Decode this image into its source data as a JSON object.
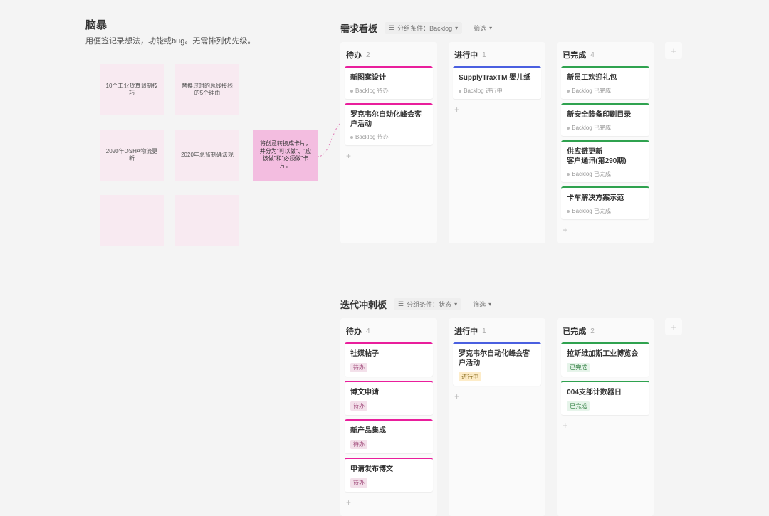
{
  "brainstorm": {
    "title": "脑暴",
    "subtitle": "用便签记录想法，功能或bug。无需排列优先级。"
  },
  "stickies": [
    {
      "text": "10个工业货真调制技巧"
    },
    {
      "text": "替换过时的总线接线的5个理由"
    },
    {
      "text": "2020年OSHA物流更新"
    },
    {
      "text": "2020年总监制确法规"
    },
    {
      "text": ""
    },
    {
      "text": ""
    }
  ],
  "pink_sticky": {
    "text": "将创意转换成卡片，并分为\"可以做\"、\"应该做\"和\"必须做\"卡片。"
  },
  "board1": {
    "title": "需求看板",
    "filter_label": "分组条件：Backlog",
    "filter2_label": "筛选",
    "columns": [
      {
        "title": "待办",
        "count": "2",
        "accent": "accent-magenta",
        "cards": [
          {
            "title": "新图案设计",
            "meta": "Backlog 待办"
          },
          {
            "title": "罗克韦尔自动化峰会客户活动",
            "meta": "Backlog 待办"
          }
        ]
      },
      {
        "title": "进行中",
        "count": "1",
        "accent": "accent-blue",
        "cards": [
          {
            "title": "SupplyTraxTM 婴儿纸",
            "meta": "Backlog 进行中"
          }
        ]
      },
      {
        "title": "已完成",
        "count": "4",
        "accent": "accent-green",
        "cards": [
          {
            "title": "新员工欢迎礼包",
            "meta": "Backlog 已完成"
          },
          {
            "title": "新安全装备印刷目录",
            "meta": "Backlog 已完成"
          },
          {
            "title": "供应链更新\n客户通讯(第290期)",
            "meta": "Backlog 已完成"
          },
          {
            "title": "卡车解决方案示范",
            "meta": "Backlog 已完成"
          }
        ]
      }
    ]
  },
  "board2": {
    "title": "迭代冲刺板",
    "filter_label": "分组条件：状态",
    "filter2_label": "筛选",
    "columns": [
      {
        "title": "待办",
        "count": "4",
        "accent": "accent-magenta",
        "cards": [
          {
            "title": "社媒帖子",
            "tag": "待办",
            "tagclass": "todo"
          },
          {
            "title": "博文申请",
            "tag": "待办",
            "tagclass": "todo"
          },
          {
            "title": "新产品集成",
            "tag": "待办",
            "tagclass": "todo"
          },
          {
            "title": "申请发布博文",
            "tag": "待办",
            "tagclass": "todo"
          }
        ]
      },
      {
        "title": "进行中",
        "count": "1",
        "accent": "accent-blue",
        "cards": [
          {
            "title": "罗克韦尔自动化峰会客户活动",
            "tag": "进行中",
            "tagclass": "doing"
          }
        ]
      },
      {
        "title": "已完成",
        "count": "2",
        "accent": "accent-green",
        "cards": [
          {
            "title": "拉斯维加斯工业博览会",
            "tag": "已完成",
            "tagclass": ""
          },
          {
            "title": "004支部计数器日",
            "tag": "已完成",
            "tagclass": ""
          }
        ]
      }
    ]
  },
  "icons": {
    "plus": "+",
    "chevron": "▾",
    "group": "☰"
  }
}
